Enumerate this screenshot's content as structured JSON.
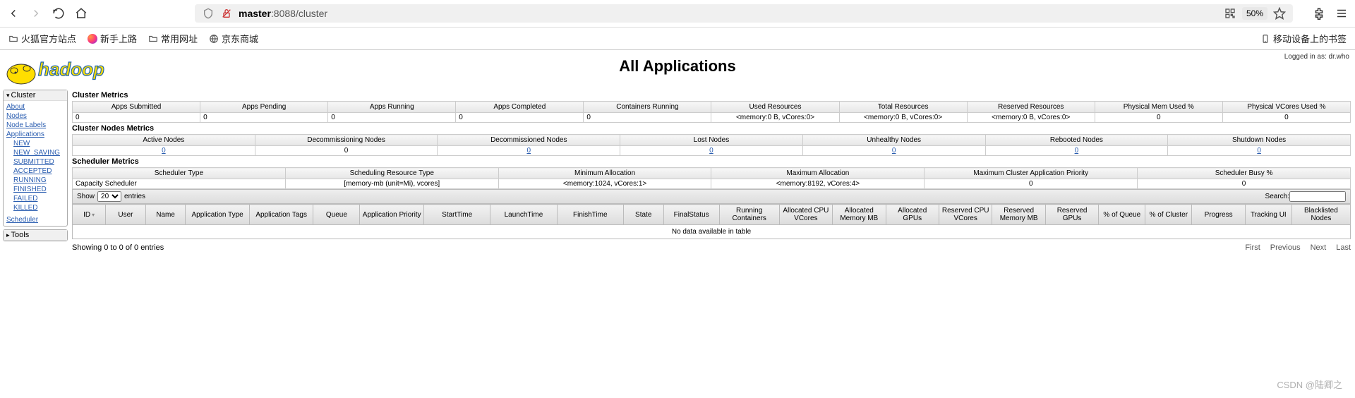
{
  "browser": {
    "url_host": "master",
    "url_path": ":8088/cluster",
    "zoom": "50%"
  },
  "bookmarks": {
    "b1": "火狐官方站点",
    "b2": "新手上路",
    "b3": "常用网址",
    "b4": "京东商城",
    "mobile": "移动设备上的书签"
  },
  "header": {
    "title": "All Applications",
    "login": "Logged in as: dr.who"
  },
  "sidebar": {
    "cluster": {
      "title": "Cluster",
      "about": "About",
      "nodes": "Nodes",
      "node_labels": "Node Labels",
      "applications": "Applications",
      "states": {
        "new": "NEW",
        "new_saving": "NEW_SAVING",
        "submitted": "SUBMITTED",
        "accepted": "ACCEPTED",
        "running": "RUNNING",
        "finished": "FINISHED",
        "failed": "FAILED",
        "killed": "KILLED"
      },
      "scheduler": "Scheduler"
    },
    "tools": {
      "title": "Tools"
    }
  },
  "cluster_metrics": {
    "title": "Cluster Metrics",
    "headers": {
      "apps_submitted": "Apps Submitted",
      "apps_pending": "Apps Pending",
      "apps_running": "Apps Running",
      "apps_completed": "Apps Completed",
      "containers_running": "Containers Running",
      "used_resources": "Used Resources",
      "total_resources": "Total Resources",
      "reserved_resources": "Reserved Resources",
      "phys_mem": "Physical Mem Used %",
      "phys_vcores": "Physical VCores Used %"
    },
    "values": {
      "apps_submitted": "0",
      "apps_pending": "0",
      "apps_running": "0",
      "apps_completed": "0",
      "containers_running": "0",
      "used_resources": "<memory:0 B, vCores:0>",
      "total_resources": "<memory:0 B, vCores:0>",
      "reserved_resources": "<memory:0 B, vCores:0>",
      "phys_mem": "0",
      "phys_vcores": "0"
    }
  },
  "nodes_metrics": {
    "title": "Cluster Nodes Metrics",
    "headers": {
      "active": "Active Nodes",
      "decommissioning": "Decommissioning Nodes",
      "decommissioned": "Decommissioned Nodes",
      "lost": "Lost Nodes",
      "unhealthy": "Unhealthy Nodes",
      "rebooted": "Rebooted Nodes",
      "shutdown": "Shutdown Nodes"
    },
    "values": {
      "active": "0",
      "decommissioning": "0",
      "decommissioned": "0",
      "lost": "0",
      "unhealthy": "0",
      "rebooted": "0",
      "shutdown": "0"
    }
  },
  "scheduler_metrics": {
    "title": "Scheduler Metrics",
    "headers": {
      "type": "Scheduler Type",
      "resource_type": "Scheduling Resource Type",
      "min": "Minimum Allocation",
      "max": "Maximum Allocation",
      "priority": "Maximum Cluster Application Priority",
      "busy": "Scheduler Busy %"
    },
    "values": {
      "type": "Capacity Scheduler",
      "resource_type": "[memory-mb (unit=Mi), vcores]",
      "min": "<memory:1024, vCores:1>",
      "max": "<memory:8192, vCores:4>",
      "priority": "0",
      "busy": "0"
    }
  },
  "apps_table": {
    "show_label": "Show",
    "entries_label": "entries",
    "page_size": "20",
    "search_label": "Search:",
    "headers": {
      "id": "ID",
      "user": "User",
      "name": "Name",
      "app_type": "Application Type",
      "app_tags": "Application Tags",
      "queue": "Queue",
      "priority": "Application Priority",
      "start": "StartTime",
      "launch": "LaunchTime",
      "finish": "FinishTime",
      "state": "State",
      "final": "FinalStatus",
      "run_containers": "Running Containers",
      "alloc_cpu": "Allocated CPU VCores",
      "alloc_mem": "Allocated Memory MB",
      "alloc_gpu": "Allocated GPUs",
      "res_cpu": "Reserved CPU VCores",
      "res_mem": "Reserved Memory MB",
      "res_gpu": "Reserved GPUs",
      "pct_queue": "% of Queue",
      "pct_cluster": "% of Cluster",
      "progress": "Progress",
      "tracking": "Tracking UI",
      "blacklist": "Blacklisted Nodes"
    },
    "nodata": "No data available in table",
    "info": "Showing 0 to 0 of 0 entries",
    "pager": {
      "first": "First",
      "prev": "Previous",
      "next": "Next",
      "last": "Last"
    }
  },
  "watermark": "CSDN @陆卿之"
}
